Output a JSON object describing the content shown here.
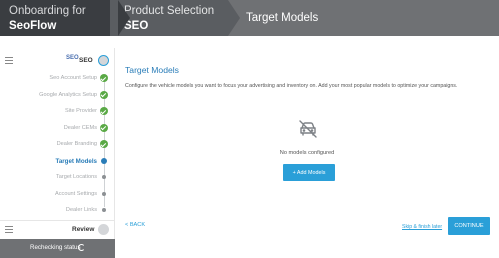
{
  "header": {
    "onboarding_line1": "Onboarding for",
    "onboarding_line2": "SeoFlow",
    "product_line1": "Product Selection",
    "product_line2": "SEO",
    "current_step": "Target Models"
  },
  "sidebar": {
    "section_logo": "SEO",
    "section_title": "SEO",
    "items": [
      {
        "label": "Seo Account Setup",
        "state": "done"
      },
      {
        "label": "Google Analytics Setup",
        "state": "done"
      },
      {
        "label": "Site Provider",
        "state": "done"
      },
      {
        "label": "Dealer CEMs",
        "state": "done"
      },
      {
        "label": "Dealer Branding",
        "state": "done"
      },
      {
        "label": "Target Models",
        "state": "current"
      },
      {
        "label": "Target Locations",
        "state": "pending"
      },
      {
        "label": "Account Settings",
        "state": "pending"
      },
      {
        "label": "Dealer Links",
        "state": "pending"
      }
    ],
    "review_label": "Review",
    "status_label": "Rechecking status"
  },
  "main": {
    "title": "Target Models",
    "description": "Configure the vehicle models you want to focus your advertising and inventory on. Add your most popular models to optimize your campaigns.",
    "empty_icon": "car-off-icon",
    "empty_text": "No models configured",
    "add_button": "+ Add Models",
    "back_link": "< BACK",
    "skip_link": "Skip & finish later",
    "continue_button": "CONTINUE"
  },
  "colors": {
    "accent": "#2a9fd8",
    "link": "#2a7db8",
    "done": "#5aa946",
    "header_dark": "#3a3d41",
    "header_mid": "#5a5d61",
    "header_light": "#6f7174"
  }
}
